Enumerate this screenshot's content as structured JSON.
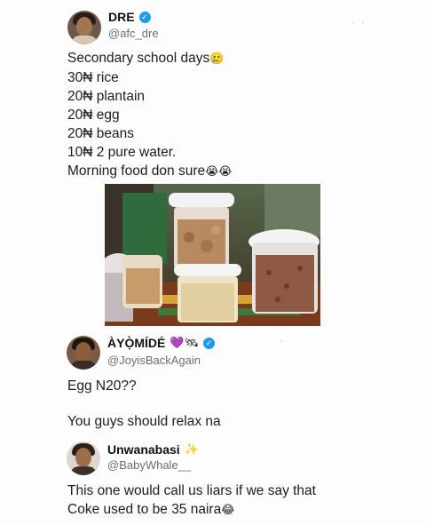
{
  "tweet1": {
    "name": "DRE",
    "handle": "@afc_dre",
    "lines": [
      "Secondary school days",
      "30₦ rice",
      "20₦ plantain",
      "20₦ egg",
      "20₦ beans",
      "10₦ 2 pure water.",
      "Morning food don sure"
    ],
    "emoji_after_line1": "🥲",
    "emoji_after_last": "😭😭"
  },
  "reply1": {
    "name": "ÀYỌ̀MÍDÉ",
    "name_emoji": "💜🛰",
    "handle": "@JoyisBackAgain",
    "lines": [
      "Egg N20??",
      "You guys should relax na"
    ]
  },
  "reply2": {
    "name": "Unwanabasi",
    "name_emoji": "✨",
    "handle": "@BabyWhale__",
    "lines": [
      "This one would call us liars if we say that",
      "Coke used to be 35 naira"
    ],
    "emoji_after_last": "😂"
  },
  "colors": {
    "verified": "#1d9bf0",
    "handle": "#6b6f74"
  }
}
